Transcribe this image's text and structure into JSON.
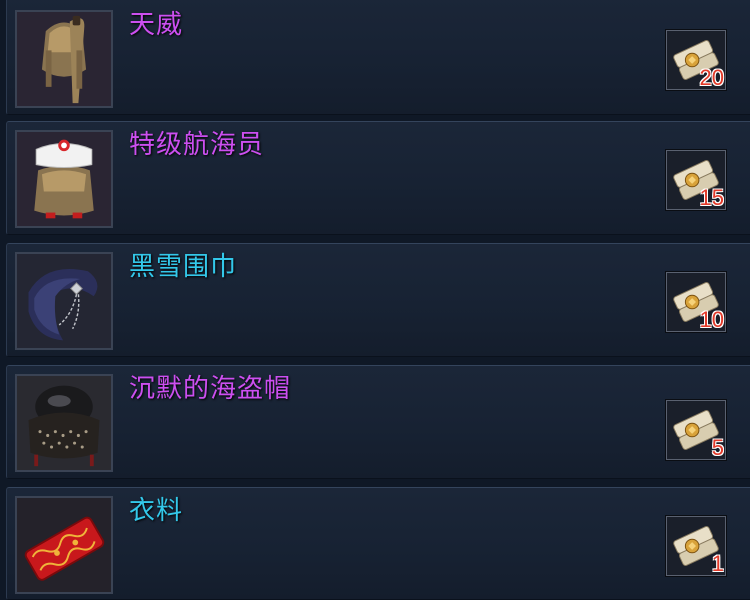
{
  "items": [
    {
      "name": "天威",
      "name_color": "#cc4ff0",
      "icon": "ponytail-hair-icon",
      "reward_icon": "scroll-token-icon",
      "quantity": "20"
    },
    {
      "name": "特级航海员",
      "name_color": "#cc4ff0",
      "icon": "sailor-hat-hair-icon",
      "reward_icon": "scroll-token-icon",
      "quantity": "15"
    },
    {
      "name": "黑雪围巾",
      "name_color": "#33c8ea",
      "icon": "dark-scarf-icon",
      "reward_icon": "scroll-token-icon",
      "quantity": "10"
    },
    {
      "name": "沉默的海盗帽",
      "name_color": "#cc4ff0",
      "icon": "pirate-hat-icon",
      "reward_icon": "scroll-token-icon",
      "quantity": "5"
    },
    {
      "name": "衣料",
      "name_color": "#33c8ea",
      "icon": "red-cloth-icon",
      "reward_icon": "scroll-token-icon",
      "quantity": "1"
    }
  ]
}
